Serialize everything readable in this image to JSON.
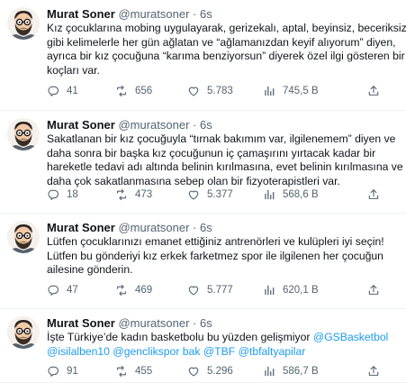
{
  "tweets": [
    {
      "author": {
        "name": "Murat Soner",
        "handle": "@muratsoner",
        "dot": "·",
        "time": "6s"
      },
      "lines": [
        [
          {
            "t": "Kız çocuklarına mobing uygulayarak, gerizekalı, aptal, beyinsiz, beceriksiz"
          }
        ],
        [
          {
            "t": "gibi kelimelerle her gün ağlatan ve “ağlamanızdan keyif alıyorum” diyen,"
          }
        ],
        [
          {
            "t": "ayrıca bir kız çocuğuna “karıma benziyorsun” diyerek özel ilgi gösteren bir"
          }
        ],
        [
          {
            "t": "koçları var."
          }
        ]
      ],
      "stats": {
        "replies": "41",
        "retweets": "656",
        "likes": "5.783",
        "views": "745,5 B"
      }
    },
    {
      "author": {
        "name": "Murat Soner",
        "handle": "@muratsoner",
        "dot": "·",
        "time": "6s"
      },
      "lines": [
        [
          {
            "t": "Sakatlanan bir kız çocuğuyla “tırnak bakımım var, ilgilenemem” diyen ve"
          }
        ],
        [
          {
            "t": "daha sonra bir başka kız çocuğunun iç çamaşırını yırtacak kadar bir"
          }
        ],
        [
          {
            "t": "hareketle tedavi adı altında belinin kırılmasına, evet belinin kırılmasına ve"
          }
        ],
        [
          {
            "t": "daha çok sakatlanmasına sebep olan bir fizyoterapistleri var."
          }
        ]
      ],
      "stats": {
        "replies": "18",
        "retweets": "473",
        "likes": "5.377",
        "views": "568,6 B"
      }
    },
    {
      "author": {
        "name": "Murat Soner",
        "handle": "@muratsoner",
        "dot": "·",
        "time": "6s"
      },
      "lines": [
        [
          {
            "t": "Lütfen çocuklarınızı emanet ettiğiniz antrenörleri ve kulüpleri iyi seçin!"
          }
        ],
        [
          {
            "t": "Lütfen bu gönderiyi kız erkek farketmez spor ile ilgilenen her çocuğun"
          }
        ],
        [
          {
            "t": "ailesine gönderin."
          }
        ]
      ],
      "stats": {
        "replies": "47",
        "retweets": "469",
        "likes": "5.777",
        "views": "620,1 B"
      }
    },
    {
      "author": {
        "name": "Murat Soner",
        "handle": "@muratsoner",
        "dot": "·",
        "time": "6s"
      },
      "lines": [
        [
          {
            "t": "İşte Türkiye’de kadın basketbolu bu yüzden gelişmiyor "
          },
          {
            "t": "@GSBasketbol",
            "m": true
          }
        ],
        [
          {
            "t": "@isilalben10",
            "m": true
          },
          {
            "t": " "
          },
          {
            "t": "@genclikspor bak",
            "m": true
          },
          {
            "t": " "
          },
          {
            "t": "@TBF",
            "m": true
          },
          {
            "t": " "
          },
          {
            "t": "@tbfaltyapilar",
            "m": true
          }
        ]
      ],
      "stats": {
        "replies": "91",
        "retweets": "455",
        "likes": "5.296",
        "views": "586,7 B"
      }
    }
  ],
  "icons": {
    "avatar": "cartoon-face-avatar",
    "reply": "reply-bubble-icon",
    "retweet": "retweet-icon",
    "like": "heart-icon",
    "views": "views-bars-icon",
    "share": "share-icon"
  },
  "colors": {
    "text": "#0f1419",
    "secondary": "#536471",
    "mention": "#1d9bf0",
    "divider": "#eff3f4"
  }
}
